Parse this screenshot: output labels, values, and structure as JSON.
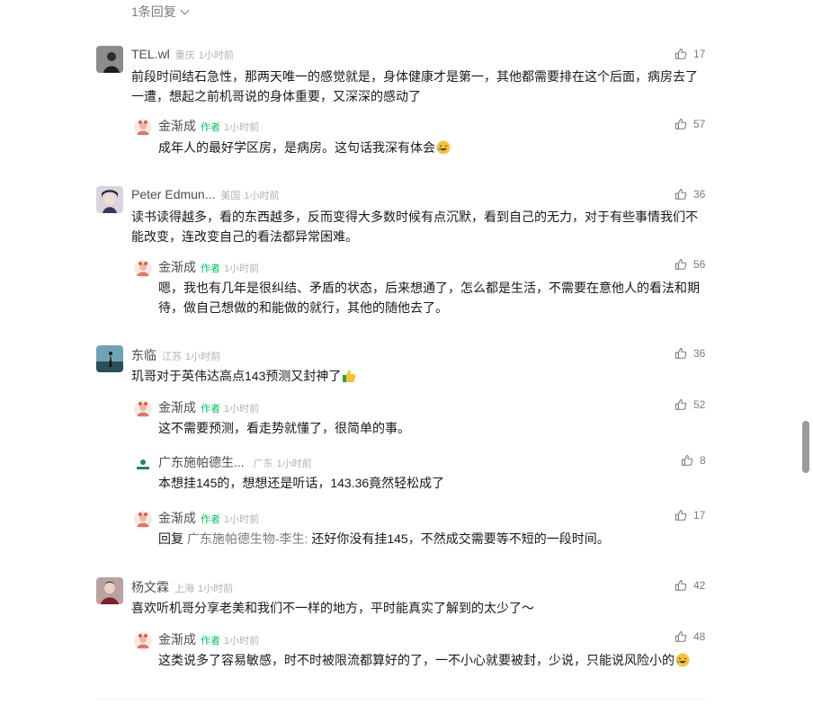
{
  "top": {
    "replies_label": "1条回复"
  },
  "comments": [
    {
      "name": "TEL.wl",
      "location": "重庆",
      "time": "1小时前",
      "likes": "17",
      "text": "前段时间结石急性，那两天唯一的感觉就是，身体健康才是第一，其他都需要排在这个后面，病房去了一遭，想起之前机哥说的身体重要，又深深的感动了",
      "replies": [
        {
          "name": "金渐成",
          "author_tag": "作者",
          "time": "1小时前",
          "likes": "57",
          "text": "成年人的最好学区房，是病房。这句话我深有体会",
          "emoji": "laugh"
        }
      ]
    },
    {
      "name": "Peter Edmun...",
      "location": "美国",
      "time": "1小时前",
      "likes": "36",
      "text": "读书读得越多，看的东西越多，反而变得大多数时候有点沉默，看到自己的无力，对于有些事情我们不能改变，连改变自己的看法都异常困难。",
      "replies": [
        {
          "name": "金渐成",
          "author_tag": "作者",
          "time": "1小时前",
          "likes": "56",
          "text": "嗯，我也有几年是很纠结、矛盾的状态，后来想通了，怎么都是生活，不需要在意他人的看法和期待，做自己想做的和能做的就行，其他的随他去了。"
        }
      ]
    },
    {
      "name": "东临",
      "location": "江苏",
      "time": "1小时前",
      "likes": "36",
      "text": "玑哥对于英伟达高点143预测又封神了",
      "emoji": "thumb",
      "replies": [
        {
          "name": "金渐成",
          "author_tag": "作者",
          "time": "1小时前",
          "likes": "52",
          "text": "这不需要预测，看走势就懂了，很简单的事。"
        },
        {
          "name": "广东施帕德生...",
          "location": "广东",
          "time": "1小时前",
          "likes": "8",
          "text": "本想挂145的，想想还是听话，143.36竟然轻松成了"
        },
        {
          "name": "金渐成",
          "author_tag": "作者",
          "time": "1小时前",
          "likes": "17",
          "reply_prefix": "回复",
          "reply_to": "广东施帕德生物-李生:",
          "text": "还好你没有挂145，不然成交需要等不短的一段时间。"
        }
      ]
    },
    {
      "name": "杨文霖",
      "location": "上海",
      "time": "1小时前",
      "likes": "42",
      "text": "喜欢听机哥分享老美和我们不一样的地方，平时能真实了解到的太少了～",
      "replies": [
        {
          "name": "金渐成",
          "author_tag": "作者",
          "time": "1小时前",
          "likes": "48",
          "text": "这类说多了容易敏感，时不时被限流都算好的了，一不小心就要被封，少说，只能说风险小的",
          "emoji": "laugh"
        }
      ]
    }
  ],
  "colors": {
    "author_green": "#07c160",
    "meta_gray": "#b2b2b2",
    "like_gray": "#7a7a7a"
  }
}
